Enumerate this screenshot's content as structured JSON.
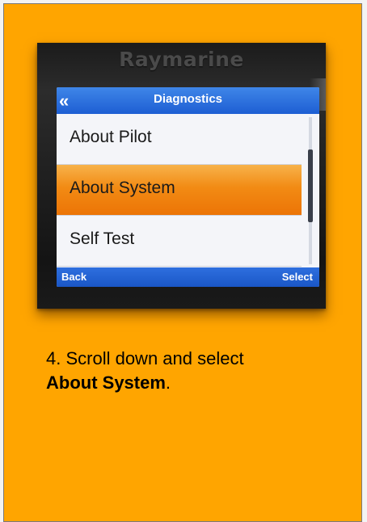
{
  "photo": {
    "brand": "Raymarine",
    "screen": {
      "title": "Diagnostics",
      "back_icon": "«",
      "menu_items": [
        {
          "label": "About Pilot",
          "selected": false
        },
        {
          "label": "About System",
          "selected": true
        },
        {
          "label": "Self Test",
          "selected": false
        }
      ],
      "softkeys": {
        "left": "Back",
        "right": "Select"
      }
    }
  },
  "instruction": {
    "step_text": "4. Scroll down and select",
    "highlight": "About System",
    "suffix": "."
  },
  "colors": {
    "page_background": "#ffa500",
    "titlebar": "#1d5ed3",
    "selected_item": "#f28b14"
  }
}
